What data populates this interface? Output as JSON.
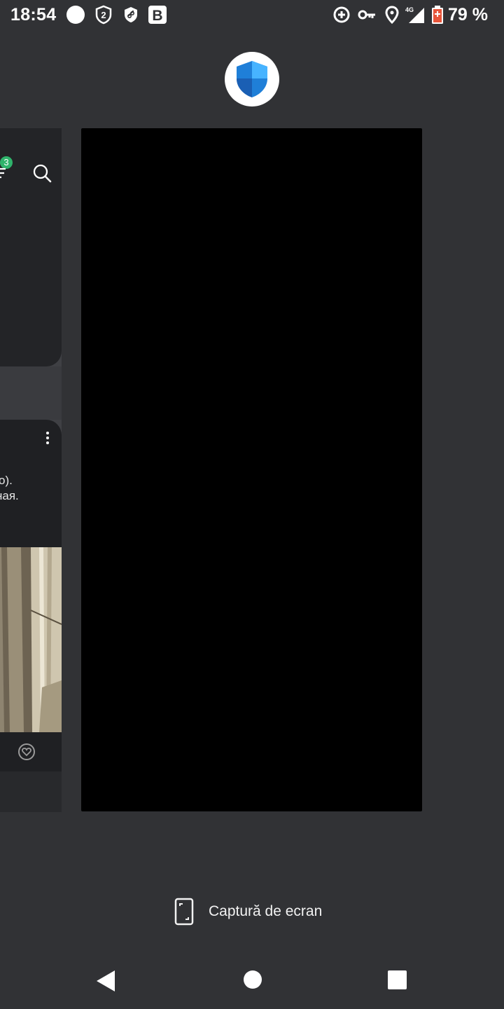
{
  "status_bar": {
    "time": "18:54",
    "battery": "79 %",
    "network": "4G",
    "icons": [
      "circle-dot-icon",
      "shield-2-icon",
      "vpn-shield-icon",
      "b-app-icon",
      "data-saver-icon",
      "key-icon",
      "location-icon",
      "signal-icon",
      "battery-icon"
    ]
  },
  "recents": {
    "focused_app_icon": "defender-shield-icon",
    "left_card": {
      "badge_count": "3",
      "text_lines": [
        "о).",
        "ная."
      ]
    }
  },
  "screenshot_action": {
    "label": "Captură de ecran",
    "icon": "screenshot-icon"
  },
  "nav": {
    "back": "back-icon",
    "home": "home-icon",
    "recents": "recents-icon"
  },
  "colors": {
    "background": "#313235",
    "card_dark": "#000000",
    "badge": "#2fb36b",
    "shield_blue": "#1f7fd8"
  }
}
